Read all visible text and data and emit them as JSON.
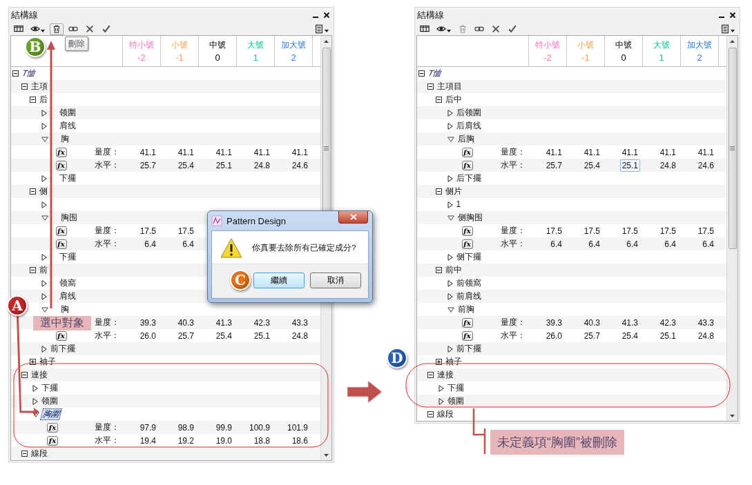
{
  "panels": [
    {
      "title": "結構線",
      "toolbar": [
        {
          "kind": "columns",
          "dropdown": false,
          "pressed": false,
          "disabled": false
        },
        {
          "kind": "view",
          "dropdown": true,
          "pressed": false,
          "disabled": false
        },
        {
          "kind": "delete",
          "dropdown": false,
          "pressed": true,
          "disabled": false,
          "tooltip": "刪除"
        },
        {
          "kind": "link",
          "dropdown": false,
          "pressed": false,
          "disabled": false
        },
        {
          "kind": "reject",
          "dropdown": false,
          "pressed": false,
          "disabled": false
        },
        {
          "kind": "accept",
          "dropdown": false,
          "pressed": false,
          "disabled": false
        },
        {
          "kind": "menu",
          "dropdown": true,
          "pressed": false,
          "disabled": false
        }
      ],
      "columns": [
        {
          "name": "特小號",
          "code": "-2",
          "color": "#ff70c0"
        },
        {
          "name": "小號",
          "code": "-1",
          "color": "#ffa040"
        },
        {
          "name": "中號",
          "code": "0",
          "color": "#000000"
        },
        {
          "name": "大號",
          "code": "1",
          "color": "#00c896"
        },
        {
          "name": "加大號",
          "code": "2",
          "color": "#2a7ae2"
        }
      ],
      "tree": [
        {
          "kind": "group",
          "label": "T恤",
          "expanded": true,
          "defined": false,
          "selected": false,
          "children": [
            {
              "kind": "group",
              "label": "主項",
              "expanded": true,
              "defined": true,
              "selected": false,
              "children": [
                {
                  "kind": "group",
                  "label": "后",
                  "expanded": true,
                  "defined": true,
                  "selected": false,
                  "children": [
                    {
                      "kind": "branch",
                      "label": "领圍",
                      "expanded": false,
                      "defined": true,
                      "selected": false,
                      "clipped_start": true
                    },
                    {
                      "kind": "branch",
                      "label": "肩线",
                      "expanded": false,
                      "defined": true,
                      "selected": false,
                      "clipped_start": true
                    },
                    {
                      "kind": "branch",
                      "label": "胸",
                      "expanded": true,
                      "defined": true,
                      "selected": false,
                      "clipped_start": true,
                      "children": [
                        {
                          "kind": "formula",
                          "button": "fx",
                          "label": "量度：",
                          "values": [
                            "41.1",
                            "41.1",
                            "41.1",
                            "41.1",
                            "41.1"
                          ]
                        },
                        {
                          "kind": "formula",
                          "button": "fx",
                          "label": "水平：",
                          "values": [
                            "25.7",
                            "25.4",
                            "25.1",
                            "24.8",
                            "24.6"
                          ]
                        }
                      ]
                    },
                    {
                      "kind": "branch",
                      "label": "下擺",
                      "expanded": false,
                      "defined": true,
                      "selected": false,
                      "clipped_start": true
                    }
                  ]
                },
                {
                  "kind": "group",
                  "label": "侧",
                  "expanded": true,
                  "defined": true,
                  "selected": false,
                  "children": [
                    {
                      "kind": "branch",
                      "expanded": false
                    },
                    {
                      "kind": "branch",
                      "label": "胸围",
                      "expanded": true,
                      "defined": true,
                      "selected": false,
                      "clipped_start": true,
                      "children": [
                        {
                          "kind": "formula",
                          "button": "fx",
                          "label": "量度：",
                          "values": [
                            "17.5",
                            "17.5"
                          ]
                        },
                        {
                          "kind": "formula",
                          "button": "fx",
                          "label": "水平：",
                          "values": [
                            "6.4",
                            "6.4"
                          ]
                        }
                      ]
                    },
                    {
                      "kind": "branch",
                      "label": "下擺",
                      "expanded": false,
                      "defined": true,
                      "selected": false,
                      "clipped_start": true
                    }
                  ]
                },
                {
                  "kind": "group",
                  "label": "前",
                  "expanded": true,
                  "defined": true,
                  "selected": false,
                  "children": [
                    {
                      "kind": "branch",
                      "label": "领窩",
                      "expanded": false,
                      "defined": true,
                      "selected": false,
                      "clipped_start": true
                    },
                    {
                      "kind": "branch",
                      "label": "肩线",
                      "expanded": false,
                      "defined": true,
                      "selected": false,
                      "clipped_start": true
                    },
                    {
                      "kind": "branch",
                      "label": "胸",
                      "expanded": true,
                      "defined": true,
                      "selected": false,
                      "clipped_start": true,
                      "children": [
                        {
                          "kind": "formula",
                          "label": "量度：",
                          "values": [
                            "39.3",
                            "40.3",
                            "41.3",
                            "42.3",
                            "43.3"
                          ]
                        },
                        {
                          "kind": "formula",
                          "button": "fx",
                          "label": "水平：",
                          "values": [
                            "26.0",
                            "25.7",
                            "25.4",
                            "25.1",
                            "24.8"
                          ]
                        }
                      ]
                    },
                    {
                      "kind": "branch",
                      "label": "前下擺",
                      "expanded": false,
                      "defined": true,
                      "selected": false
                    }
                  ]
                },
                {
                  "kind": "group",
                  "label": "袖子",
                  "expanded": false,
                  "defined": true,
                  "selected": false
                }
              ]
            },
            {
              "kind": "group",
              "label": "連接",
              "expanded": true,
              "defined": true,
              "selected": false,
              "children": [
                {
                  "kind": "branch",
                  "label": "下擺",
                  "expanded": false,
                  "defined": true,
                  "selected": false
                },
                {
                  "kind": "branch",
                  "label": "领圍",
                  "expanded": false,
                  "defined": true,
                  "selected": false
                },
                {
                  "kind": "branch",
                  "label": "胸圍",
                  "expanded": true,
                  "defined": false,
                  "selected": true,
                  "children": [
                    {
                      "kind": "formula",
                      "button": "fx",
                      "label": "量度：",
                      "values": [
                        "97.9",
                        "98.9",
                        "99.9",
                        "100.9",
                        "101.9"
                      ]
                    },
                    {
                      "kind": "formula",
                      "button": "fx",
                      "label": "水平：",
                      "values": [
                        "19.4",
                        "19.2",
                        "19.0",
                        "18.8",
                        "18.6"
                      ]
                    }
                  ]
                }
              ]
            },
            {
              "kind": "group",
              "label": "線段",
              "expanded": true,
              "defined": true,
              "selected": false
            }
          ]
        }
      ]
    },
    {
      "title": "結構線",
      "toolbar": [
        {
          "kind": "columns",
          "dropdown": false,
          "pressed": false,
          "disabled": false
        },
        {
          "kind": "view",
          "dropdown": true,
          "pressed": false,
          "disabled": false
        },
        {
          "kind": "delete",
          "dropdown": false,
          "pressed": false,
          "disabled": true
        },
        {
          "kind": "link",
          "dropdown": false,
          "pressed": false,
          "disabled": false
        },
        {
          "kind": "reject",
          "dropdown": false,
          "pressed": false,
          "disabled": false
        },
        {
          "kind": "accept",
          "dropdown": false,
          "pressed": false,
          "disabled": false
        },
        {
          "kind": "menu",
          "dropdown": true,
          "pressed": false,
          "disabled": false
        }
      ],
      "columns": [
        {
          "name": "特小號",
          "code": "-2",
          "color": "#ff70c0"
        },
        {
          "name": "小號",
          "code": "-1",
          "color": "#ffa040"
        },
        {
          "name": "中號",
          "code": "0",
          "color": "#000000"
        },
        {
          "name": "大號",
          "code": "1",
          "color": "#00c896"
        },
        {
          "name": "加大號",
          "code": "2",
          "color": "#2a7ae2"
        }
      ],
      "tree": [
        {
          "kind": "group",
          "label": "T恤",
          "expanded": true,
          "defined": false,
          "selected": false,
          "children": [
            {
              "kind": "group",
              "label": "主項目",
              "expanded": true,
              "defined": true,
              "selected": false,
              "children": [
                {
                  "kind": "group",
                  "label": "后中",
                  "expanded": true,
                  "defined": true,
                  "selected": false,
                  "children": [
                    {
                      "kind": "branch",
                      "label": "后领圍",
                      "expanded": false,
                      "defined": true,
                      "selected": false
                    },
                    {
                      "kind": "branch",
                      "label": "后肩线",
                      "expanded": false,
                      "defined": true,
                      "selected": false
                    },
                    {
                      "kind": "branch",
                      "label": "后胸",
                      "expanded": true,
                      "defined": true,
                      "selected": false,
                      "children": [
                        {
                          "kind": "formula",
                          "button": "fx",
                          "label": "量度：",
                          "values": [
                            "41.1",
                            "41.1",
                            "41.1",
                            "41.1",
                            "41.1"
                          ]
                        },
                        {
                          "kind": "formula",
                          "button": "fx",
                          "label": "水平：",
                          "values": [
                            "25.7",
                            "25.4",
                            "25.1",
                            "24.8",
                            "24.6"
                          ],
                          "selected_cells": [
                            false,
                            false,
                            true,
                            false,
                            false
                          ]
                        }
                      ]
                    },
                    {
                      "kind": "branch",
                      "label": "后下擺",
                      "expanded": false,
                      "defined": true,
                      "selected": false
                    }
                  ]
                },
                {
                  "kind": "group",
                  "label": "侧片",
                  "expanded": true,
                  "defined": true,
                  "selected": false,
                  "children": [
                    {
                      "kind": "branch",
                      "label": "1",
                      "expanded": false,
                      "defined": true,
                      "selected": false
                    },
                    {
                      "kind": "branch",
                      "label": "侧胸围",
                      "expanded": true,
                      "defined": true,
                      "selected": false,
                      "children": [
                        {
                          "kind": "formula",
                          "button": "fx",
                          "label": "量度：",
                          "values": [
                            "17.5",
                            "17.5",
                            "17.5",
                            "17.5",
                            "17.5"
                          ]
                        },
                        {
                          "kind": "formula",
                          "button": "fx",
                          "label": "水平：",
                          "values": [
                            "6.4",
                            "6.4",
                            "6.4",
                            "6.4",
                            "6.4"
                          ]
                        }
                      ]
                    },
                    {
                      "kind": "branch",
                      "label": "侧下擺",
                      "expanded": false,
                      "defined": true,
                      "selected": false
                    }
                  ]
                },
                {
                  "kind": "group",
                  "label": "前中",
                  "expanded": true,
                  "defined": true,
                  "selected": false,
                  "children": [
                    {
                      "kind": "branch",
                      "label": "前领窩",
                      "expanded": false,
                      "defined": true,
                      "selected": false
                    },
                    {
                      "kind": "branch",
                      "label": "前肩线",
                      "expanded": false,
                      "defined": true,
                      "selected": false
                    },
                    {
                      "kind": "branch",
                      "label": "前胸",
                      "expanded": true,
                      "defined": true,
                      "selected": false,
                      "children": [
                        {
                          "kind": "formula",
                          "button": "fx",
                          "label": "量度：",
                          "values": [
                            "39.3",
                            "40.3",
                            "41.3",
                            "42.3",
                            "43.3"
                          ]
                        },
                        {
                          "kind": "formula",
                          "button": "fx",
                          "label": "水平：",
                          "values": [
                            "26.0",
                            "25.7",
                            "25.4",
                            "25.1",
                            "24.8"
                          ]
                        }
                      ]
                    },
                    {
                      "kind": "branch",
                      "label": "前下擺",
                      "expanded": false,
                      "defined": true,
                      "selected": false
                    }
                  ]
                },
                {
                  "kind": "group",
                  "label": "袖子",
                  "expanded": false,
                  "defined": true,
                  "selected": false
                }
              ]
            },
            {
              "kind": "group",
              "label": "連接",
              "expanded": true,
              "defined": true,
              "selected": false,
              "children": [
                {
                  "kind": "branch",
                  "label": "下擺",
                  "expanded": false,
                  "defined": true,
                  "selected": false
                },
                {
                  "kind": "branch",
                  "label": "领圍",
                  "expanded": false,
                  "defined": true,
                  "selected": false
                }
              ]
            },
            {
              "kind": "group",
              "label": "線段",
              "expanded": true,
              "defined": true,
              "selected": false
            }
          ]
        }
      ]
    }
  ],
  "dialog": {
    "title": "Pattern Design",
    "message": "你真要去除所有已確定成分?",
    "buttons": [
      {
        "label": "繼續",
        "default": true
      },
      {
        "label": "取消",
        "default": false
      }
    ]
  },
  "badges": [
    {
      "letter": "A",
      "color": "#c8282a"
    },
    {
      "letter": "B",
      "color": "#6aa428"
    },
    {
      "letter": "C",
      "color": "#e8761c"
    },
    {
      "letter": "D",
      "color": "#2a62b8"
    }
  ],
  "callouts": [
    "選中對象",
    "未定義項“胸圍”被刪除"
  ]
}
